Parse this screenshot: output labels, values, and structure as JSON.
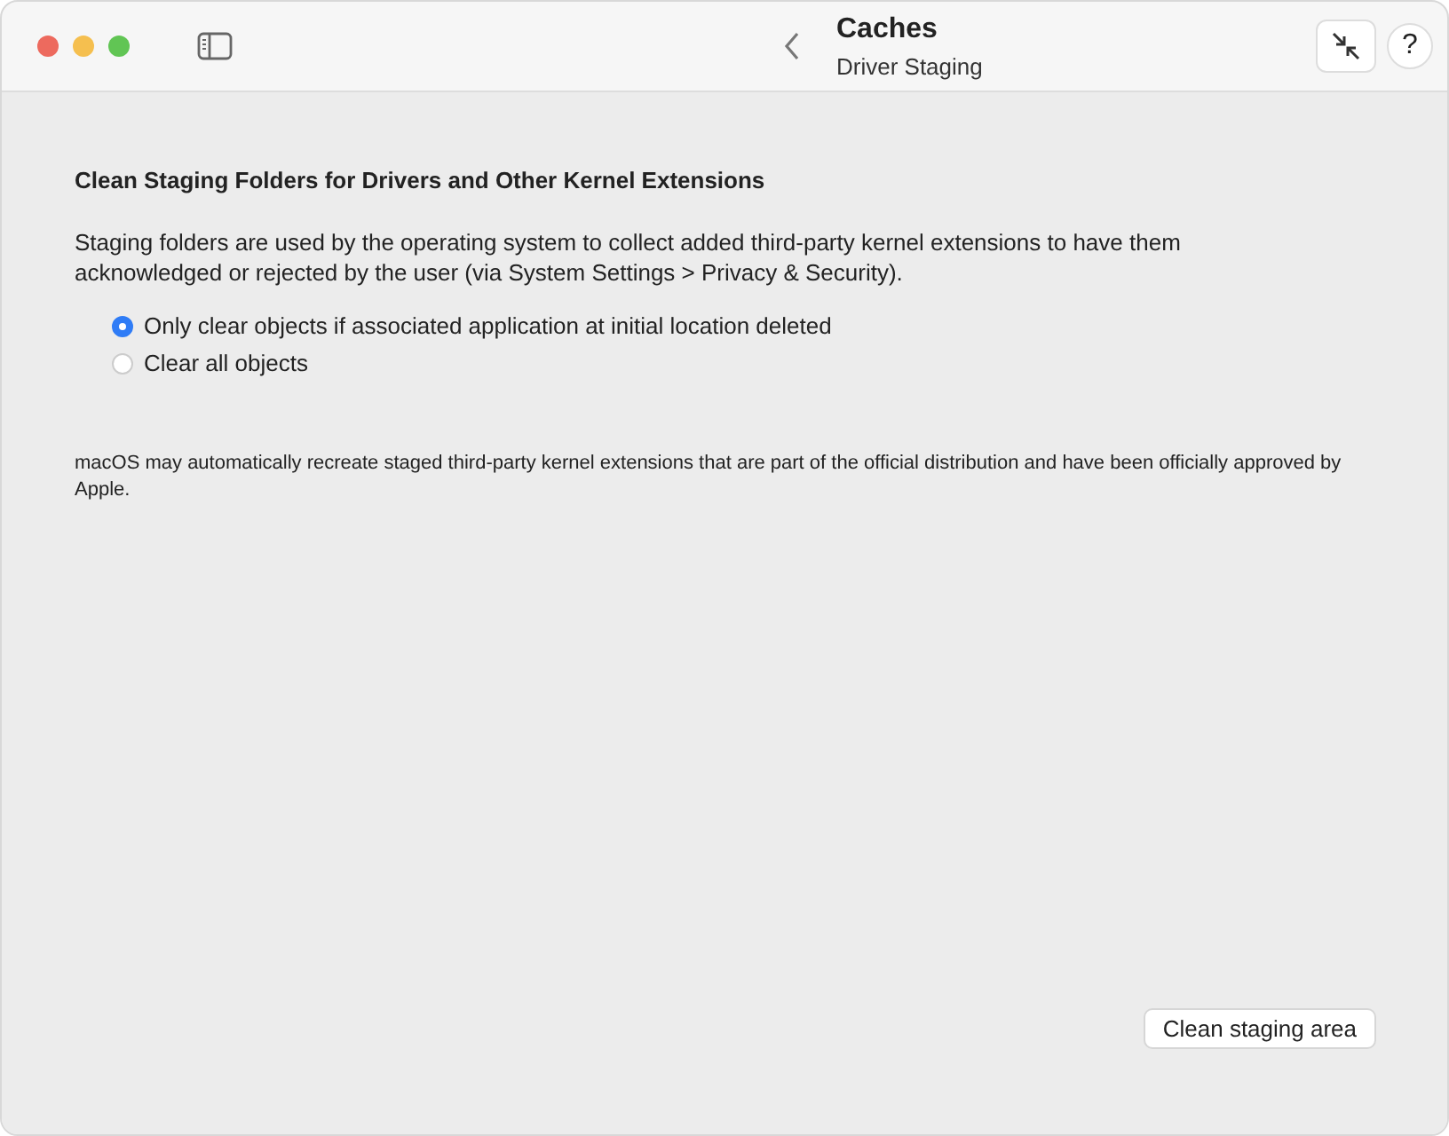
{
  "toolbar": {
    "title": "Caches",
    "subtitle": "Driver Staging",
    "help": "?"
  },
  "section": {
    "heading": "Clean Staging Folders for Drivers and Other Kernel Extensions",
    "description": "Staging folders are used by the operating system to collect added third-party kernel extensions to have them acknowledged or rejected by the user (via System Settings > Privacy & Security).",
    "options": [
      {
        "label": "Only clear objects if associated application at initial location deleted",
        "selected": true
      },
      {
        "label": "Clear all objects",
        "selected": false
      }
    ],
    "note": "macOS may automatically recreate staged third-party kernel extensions that are part of the official distribution and have been officially approved by Apple."
  },
  "buttons": [
    "Clean staging area"
  ]
}
